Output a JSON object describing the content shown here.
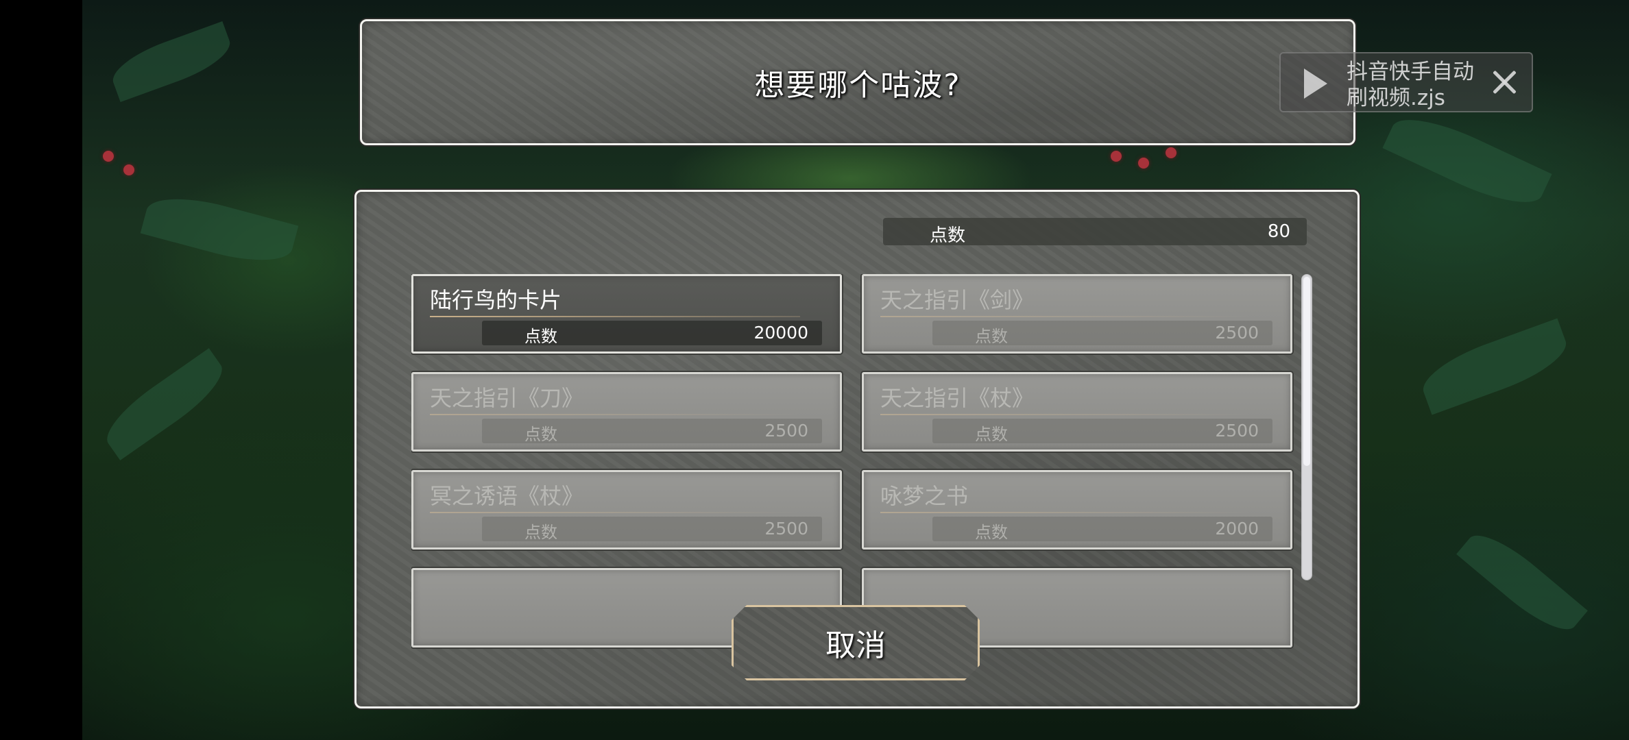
{
  "dialog": {
    "title": "想要哪个咕波?"
  },
  "points": {
    "label": "点数",
    "value": "80"
  },
  "items": [
    {
      "name": "陆行鸟的卡片",
      "cost_label": "点数",
      "cost": "20000",
      "selected": true
    },
    {
      "name": "天之指引《剑》",
      "cost_label": "点数",
      "cost": "2500",
      "selected": false
    },
    {
      "name": "天之指引《刀》",
      "cost_label": "点数",
      "cost": "2500",
      "selected": false
    },
    {
      "name": "天之指引《杖》",
      "cost_label": "点数",
      "cost": "2500",
      "selected": false
    },
    {
      "name": "冥之诱语《杖》",
      "cost_label": "点数",
      "cost": "2500",
      "selected": false
    },
    {
      "name": "咏梦之书",
      "cost_label": "点数",
      "cost": "2000",
      "selected": false
    }
  ],
  "buttons": {
    "cancel": "取消"
  },
  "overlay": {
    "text": "抖音快手自动刷视频.zjs",
    "play_icon": "play-icon",
    "close_icon": "close-icon"
  },
  "colors": {
    "panel": "#5d5f5b",
    "border": "#f4f4f0",
    "button_border": "#d9c4a0",
    "selected_item": "#5a5b58",
    "disabled_item": "#8f8f8c"
  }
}
